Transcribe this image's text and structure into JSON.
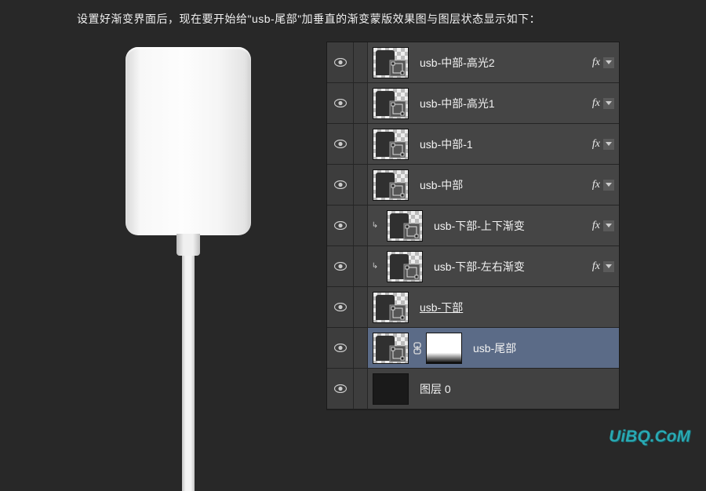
{
  "instruction_text": "设置好渐变界面后，现在要开始给\"usb-尾部\"加垂直的渐变蒙版效果图与图层状态显示如下：",
  "watermark": "UiBQ.CoM",
  "fx_label": "fx",
  "layers": [
    {
      "name": "usb-中部-高光2",
      "visible": true,
      "fx": true,
      "clipped": false,
      "selected": false,
      "mask": false,
      "underline": false,
      "thumb": "shape"
    },
    {
      "name": "usb-中部-高光1",
      "visible": true,
      "fx": true,
      "clipped": false,
      "selected": false,
      "mask": false,
      "underline": false,
      "thumb": "shape"
    },
    {
      "name": "usb-中部-1",
      "visible": true,
      "fx": true,
      "clipped": false,
      "selected": false,
      "mask": false,
      "underline": false,
      "thumb": "shape"
    },
    {
      "name": "usb-中部",
      "visible": true,
      "fx": true,
      "clipped": false,
      "selected": false,
      "mask": false,
      "underline": false,
      "thumb": "shape"
    },
    {
      "name": "usb-下部-上下渐变",
      "visible": true,
      "fx": true,
      "clipped": true,
      "selected": false,
      "mask": false,
      "underline": false,
      "thumb": "shape"
    },
    {
      "name": "usb-下部-左右渐变",
      "visible": true,
      "fx": true,
      "clipped": true,
      "selected": false,
      "mask": false,
      "underline": false,
      "thumb": "shape"
    },
    {
      "name": "usb-下部",
      "visible": true,
      "fx": false,
      "clipped": false,
      "selected": false,
      "mask": false,
      "underline": true,
      "thumb": "shape"
    },
    {
      "name": "usb-尾部",
      "visible": true,
      "fx": false,
      "clipped": false,
      "selected": true,
      "mask": true,
      "underline": false,
      "thumb": "shape"
    },
    {
      "name": "图层 0",
      "visible": true,
      "fx": false,
      "clipped": false,
      "selected": false,
      "mask": false,
      "underline": false,
      "thumb": "dark"
    }
  ]
}
